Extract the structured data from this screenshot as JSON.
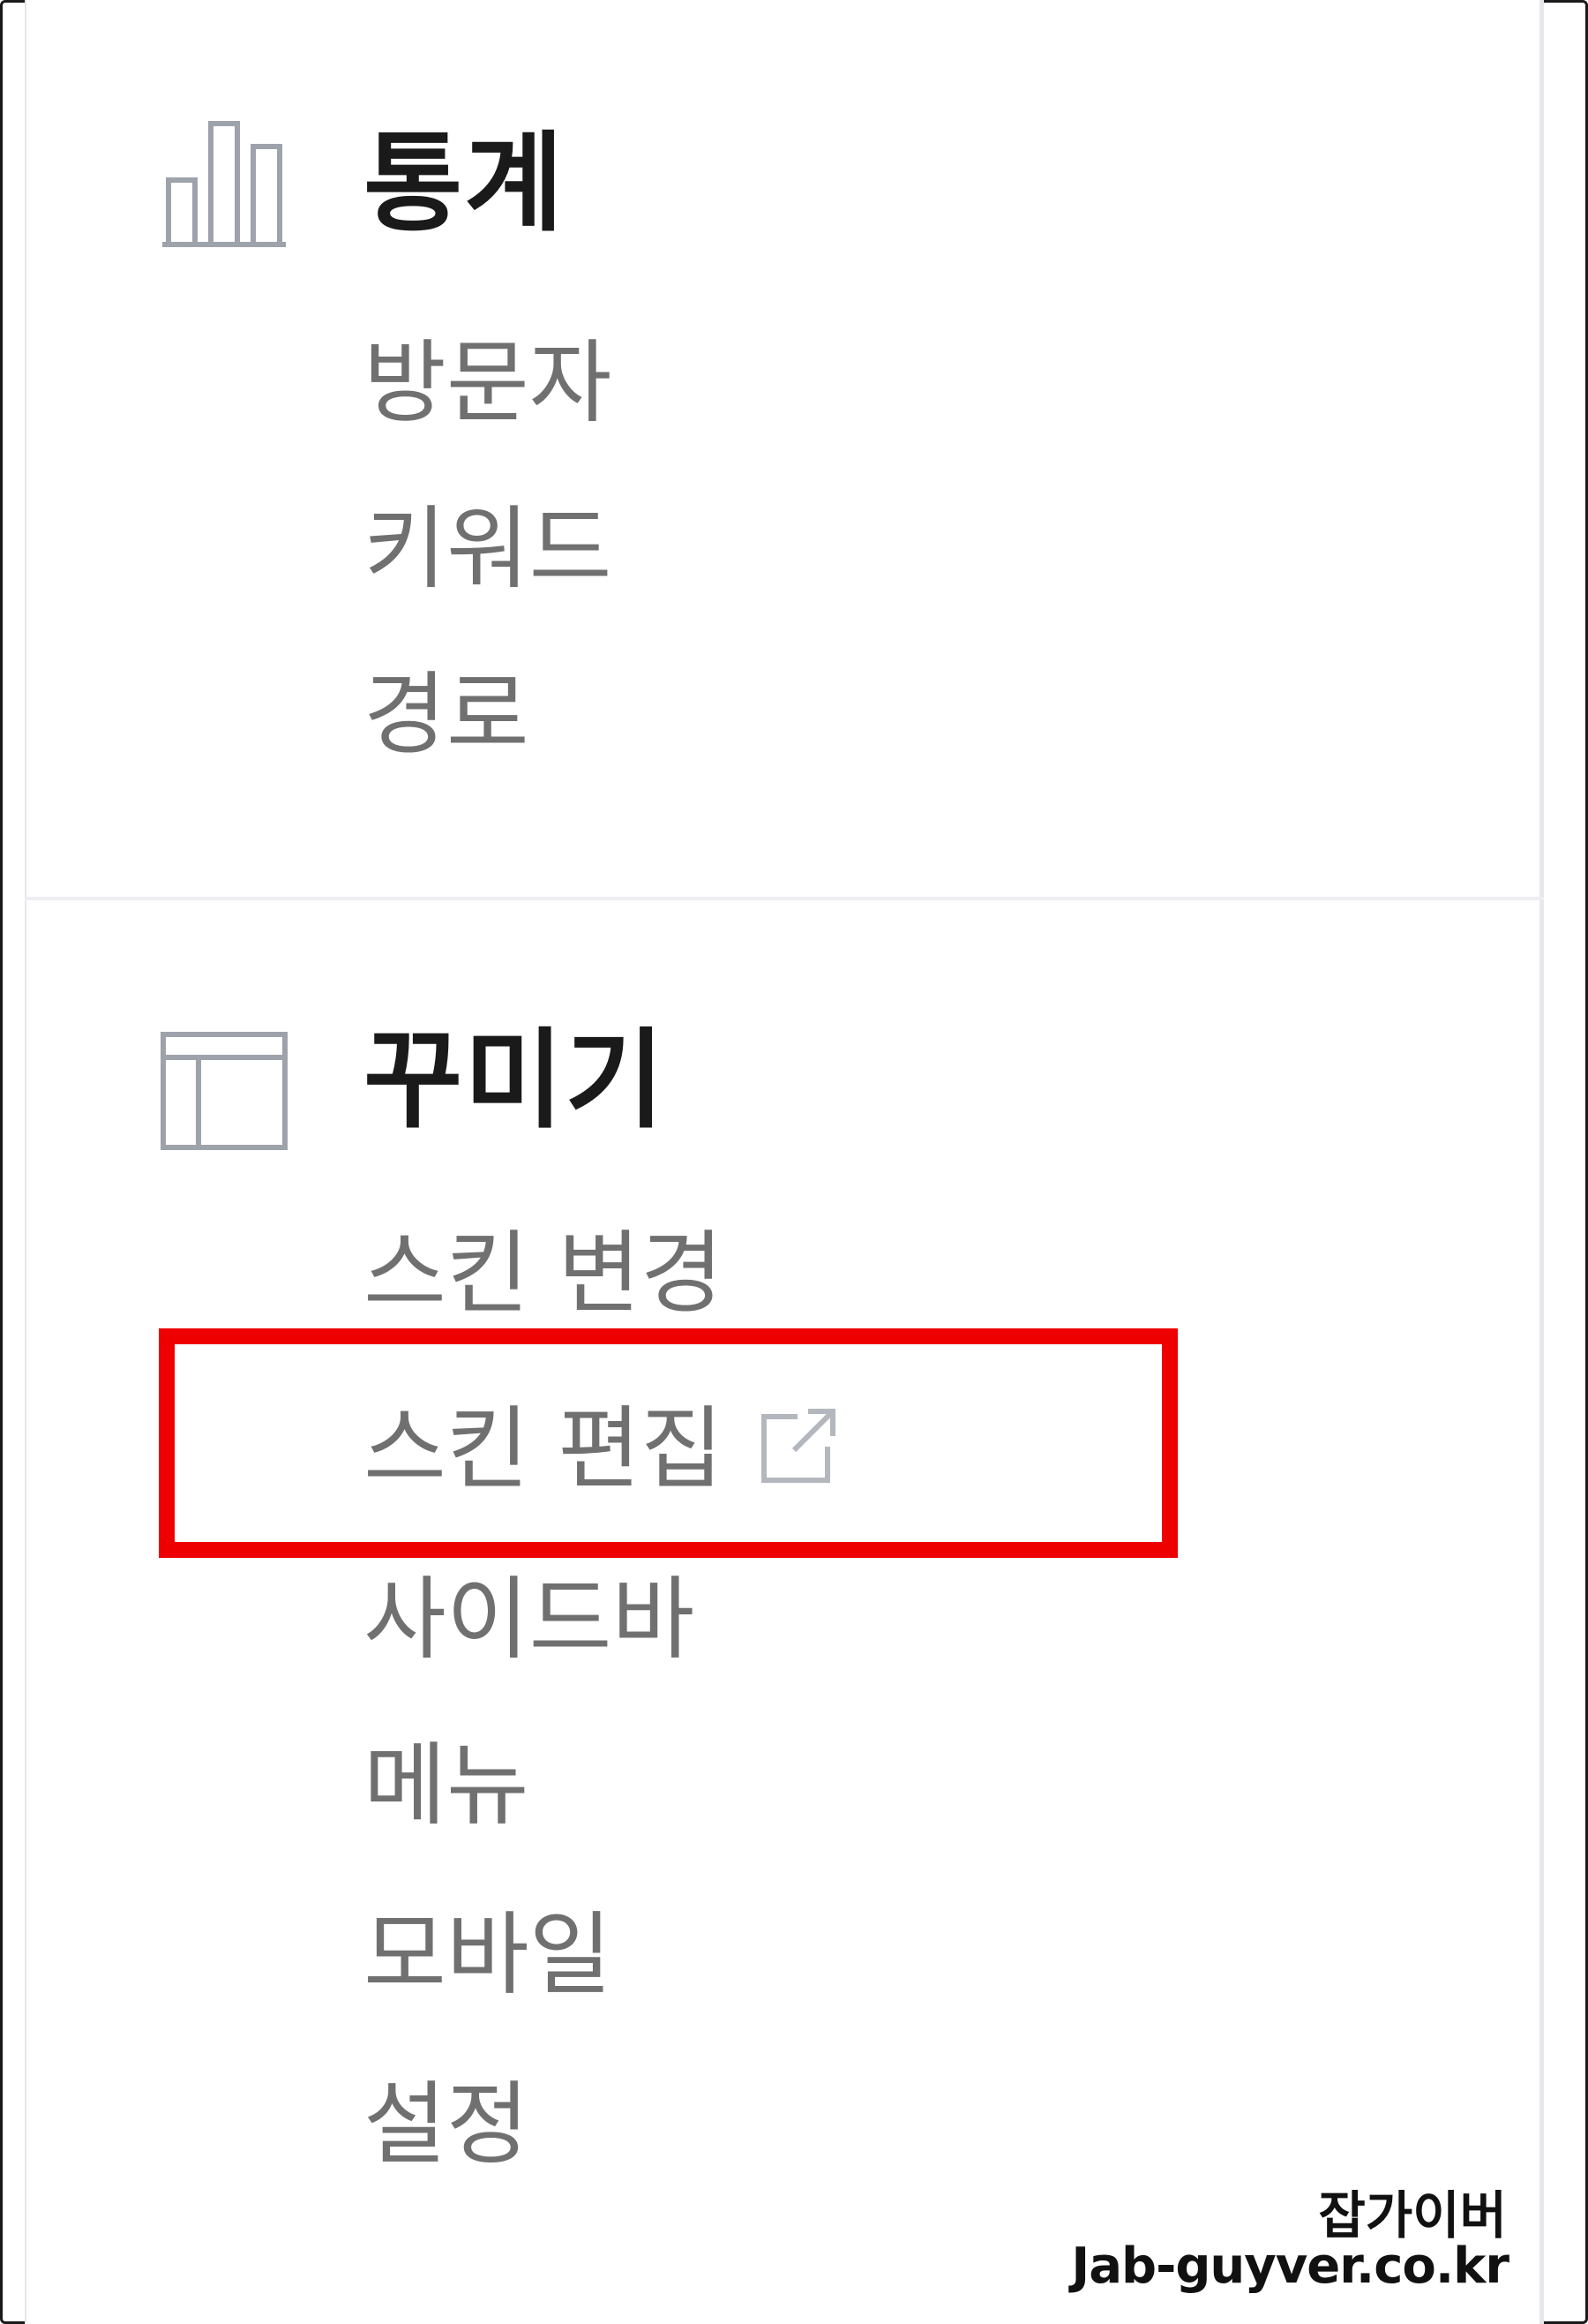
{
  "sections": [
    {
      "title": "통계",
      "icon": "bar-chart-icon",
      "items": [
        "방문자",
        "키워드",
        "경로"
      ]
    },
    {
      "title": "꾸미기",
      "icon": "layout-icon",
      "items": [
        "스킨 변경",
        "스킨 편집",
        "사이드바",
        "메뉴",
        "모바일",
        "설정"
      ]
    }
  ],
  "highlighted_item": "스킨 편집",
  "external_link_icon": "external-link-icon",
  "colors": {
    "highlight": "#ee0000",
    "menu_text": "#707070",
    "title_text": "#1a1a1a"
  },
  "watermark": {
    "name": "잡가이버",
    "site": "Jab-guyver.co.kr"
  }
}
